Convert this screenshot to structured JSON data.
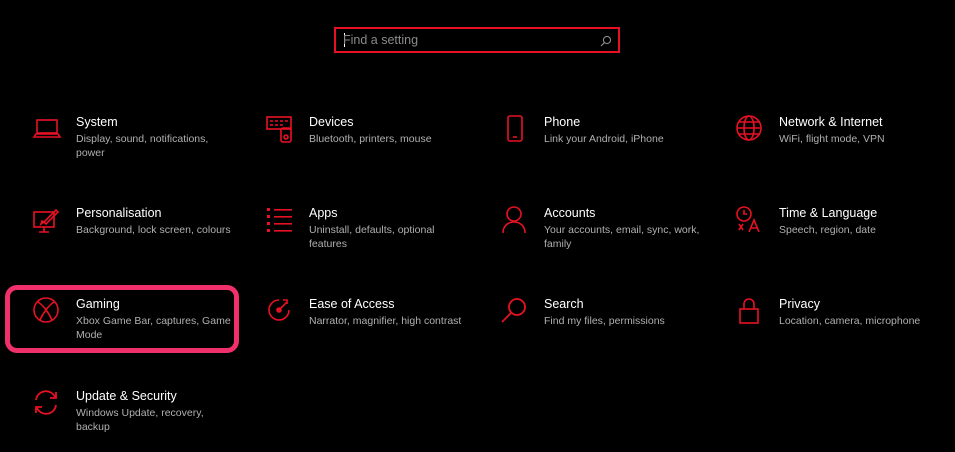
{
  "search": {
    "placeholder": "Find a setting"
  },
  "colors": {
    "accent": "#e81123",
    "highlight": "#f0306a",
    "background": "#000000"
  },
  "tiles": [
    {
      "title": "System",
      "description": "Display, sound, notifications, power",
      "icon": "laptop-icon"
    },
    {
      "title": "Devices",
      "description": "Bluetooth, printers, mouse",
      "icon": "devices-icon"
    },
    {
      "title": "Phone",
      "description": "Link your Android, iPhone",
      "icon": "phone-icon"
    },
    {
      "title": "Network & Internet",
      "description": "WiFi, flight mode, VPN",
      "icon": "globe-icon"
    },
    {
      "title": "Personalisation",
      "description": "Background, lock screen, colours",
      "icon": "paint-icon"
    },
    {
      "title": "Apps",
      "description": "Uninstall, defaults, optional features",
      "icon": "apps-list-icon"
    },
    {
      "title": "Accounts",
      "description": "Your accounts, email, sync, work, family",
      "icon": "person-icon"
    },
    {
      "title": "Time & Language",
      "description": "Speech, region, date",
      "icon": "time-language-icon"
    },
    {
      "title": "Gaming",
      "description": "Xbox Game Bar, captures, Game Mode",
      "icon": "xbox-icon"
    },
    {
      "title": "Ease of Access",
      "description": "Narrator, magnifier, high contrast",
      "icon": "ease-of-access-icon"
    },
    {
      "title": "Search",
      "description": "Find my files, permissions",
      "icon": "search-icon"
    },
    {
      "title": "Privacy",
      "description": "Location, camera, microphone",
      "icon": "lock-icon"
    },
    {
      "title": "Update & Security",
      "description": "Windows Update, recovery, backup",
      "icon": "update-icon"
    }
  ]
}
